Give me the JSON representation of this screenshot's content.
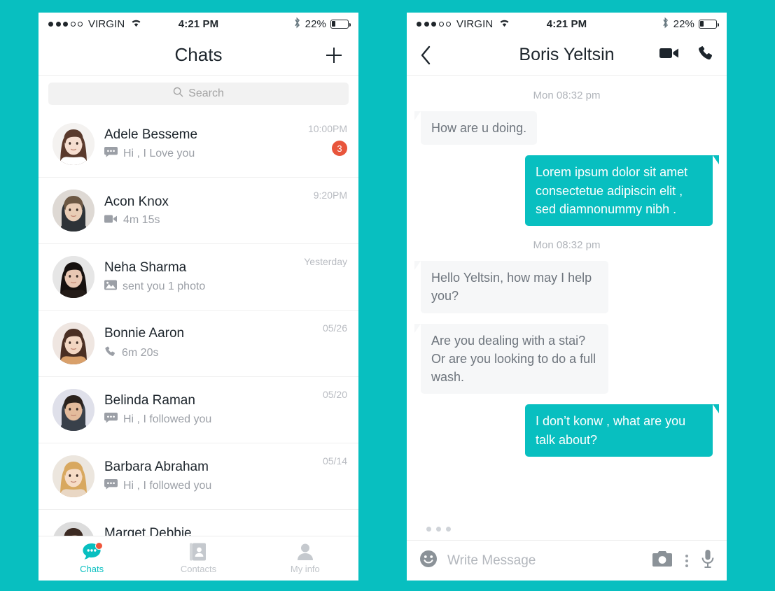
{
  "theme": {
    "teal": "#08bfc0",
    "badge_red": "#e8553c",
    "bubble_in_bg": "#f6f7f8",
    "text_dark": "#1d252c",
    "text_muted": "#9b9fa6"
  },
  "status_bar": {
    "carrier": "VIRGIN",
    "time": "4:21 PM",
    "battery_pct": "22%",
    "signal_filled": 3,
    "signal_total": 5,
    "battery_level": 22
  },
  "left_phone": {
    "nav": {
      "title": "Chats",
      "add_label": "+"
    },
    "search": {
      "placeholder": "Search"
    },
    "chats": [
      {
        "name": "Adele Besseme",
        "preview": "Hi , I Love you",
        "icon": "chat-bubble-icon",
        "time": "10:00PM",
        "badge": "3",
        "avatar": "woman-brunette"
      },
      {
        "name": "Acon Knox",
        "preview": "4m 15s",
        "icon": "video-camera-icon",
        "time": "9:20PM",
        "badge": "",
        "avatar": "man-blond"
      },
      {
        "name": "Neha Sharma",
        "preview": "sent you 1 photo",
        "icon": "photo-icon",
        "time": "Yesterday",
        "badge": "",
        "avatar": "woman-dark-hair"
      },
      {
        "name": "Bonnie  Aaron",
        "preview": "6m 20s",
        "icon": "phone-icon",
        "time": "05/26",
        "badge": "",
        "avatar": "woman-long-hair"
      },
      {
        "name": "Belinda Raman",
        "preview": "Hi , I followed you",
        "icon": "chat-bubble-icon",
        "time": "05/20",
        "badge": "",
        "avatar": "man-beard"
      },
      {
        "name": "Barbara  Abraham",
        "preview": "Hi , I followed you",
        "icon": "chat-bubble-icon",
        "time": "05/14",
        "badge": "",
        "avatar": "woman-blonde"
      },
      {
        "name": "Marget Debbie",
        "preview": "",
        "icon": "chat-bubble-icon",
        "time": "",
        "badge": "",
        "avatar": "woman-curly"
      }
    ],
    "tabs": [
      {
        "label": "Chats",
        "icon": "chat-bubble-icon",
        "active": true,
        "dot": true
      },
      {
        "label": "Contacts",
        "icon": "contacts-book-icon",
        "active": false,
        "dot": false
      },
      {
        "label": "My info",
        "icon": "person-icon",
        "active": false,
        "dot": false
      }
    ]
  },
  "right_phone": {
    "nav": {
      "back": "‹",
      "title": "Boris Yeltsin",
      "video_icon": "video-camera-icon",
      "call_icon": "phone-icon"
    },
    "conversation": [
      {
        "type": "daystamp",
        "text": "Mon 08:32 pm"
      },
      {
        "type": "in",
        "text": "How are u doing."
      },
      {
        "type": "out",
        "text": "Lorem ipsum dolor sit amet consectetue adipiscin elit , sed diamnonummy nibh ."
      },
      {
        "type": "daystamp",
        "text": "Mon 08:32 pm"
      },
      {
        "type": "in",
        "text": "Hello Yeltsin, how may I help you?"
      },
      {
        "type": "in",
        "text": "Are you dealing with a stai? Or are you looking to do a full wash."
      },
      {
        "type": "out",
        "text": "I don’t konw , what are you talk about?"
      }
    ],
    "typing_indicator": true,
    "composer": {
      "emoji_icon": "smiley-icon",
      "placeholder": "Write Message",
      "camera_icon": "camera-icon",
      "more_icon": "vertical-dots-icon",
      "mic_icon": "microphone-icon"
    }
  }
}
